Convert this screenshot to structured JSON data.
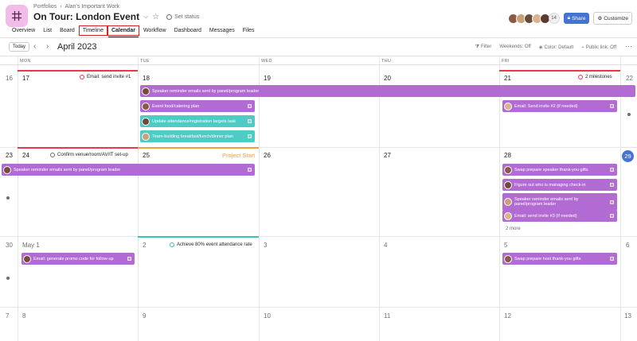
{
  "breadcrumb": {
    "portfolios": "Portfolios",
    "sep": "›",
    "parent": "Alan's Important Work"
  },
  "project": {
    "title": "On Tour: London Event",
    "set_status": "Set status"
  },
  "header": {
    "member_count": "14",
    "share": "Share",
    "customize": "Customize"
  },
  "tabs": [
    "Overview",
    "List",
    "Board",
    "Timeline",
    "Calendar",
    "Workflow",
    "Dashboard",
    "Messages",
    "Files"
  ],
  "toolbar": {
    "today": "Today",
    "month": "April 2023",
    "filter": "Filter",
    "weekends": "Weekends: Off",
    "color": "Color: Default",
    "public_link": "Public link: Off"
  },
  "day_headers": [
    "MON",
    "TUE",
    "WED",
    "THU",
    "FRI"
  ],
  "weeks": [
    {
      "left": "16",
      "days": [
        "17",
        "18",
        "19",
        "20",
        "21"
      ],
      "right": "22"
    },
    {
      "left": "23",
      "days": [
        "24",
        "25",
        "26",
        "27",
        "28"
      ],
      "right": "29"
    },
    {
      "left": "30",
      "days": [
        "May 1",
        "2",
        "3",
        "4",
        "5"
      ],
      "right": "6"
    },
    {
      "left": "7",
      "days": [
        "8",
        "9",
        "10",
        "11",
        "12"
      ],
      "right": "13"
    }
  ],
  "milestones": {
    "w1_mon": "Email: send invite #1",
    "w1_fri": "2 milestones",
    "w2_mon": "Confirm venue/room/AV/IT set-up",
    "w3_tue": "Achieve 80% event attendance rate"
  },
  "project_start": "Project Start",
  "more": "2 more",
  "tasks": {
    "w1_span": "Speaker reminder emails sent by panel/program leader",
    "w1_tue_1": "Event food/catering plan",
    "w1_tue_2": "Update attendance/registration targets task",
    "w1_tue_3": "Team-building breakfast/lunch/dinner plan",
    "w1_fri_1": "Email: Send invite #2 (if needed)",
    "w2_span": "Speaker reminder emails sent by panel/program leader",
    "w2_fri_1": "Swap prepare speaker thank-you gifts",
    "w2_fri_2": "Figure out who is managing check-in",
    "w2_fri_3": "Speaker reminder emails sent by panel/program leader",
    "w2_fri_4": "Email: send invite #3 (if needed)",
    "w3_mon_1": "Email: generate promo code for follow-up",
    "w3_fri_1": "Swap prepare host thank-you gifts"
  },
  "colors": {
    "purple_task": "#b36bd4",
    "teal_task": "#4ecbc4",
    "share_blue": "#4573d2",
    "today_blue": "#4573d2",
    "milestone_red": "#e8384f",
    "project_start_orange": "#f1a03d",
    "progress_green": "#37c5ab",
    "highlight_red": "#d2232a"
  }
}
